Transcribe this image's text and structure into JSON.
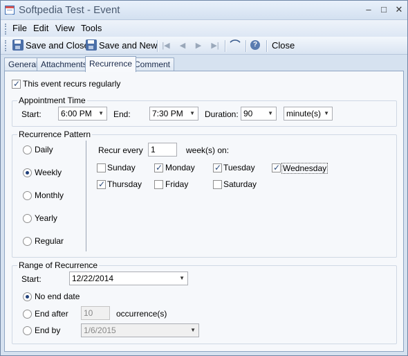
{
  "window": {
    "title": "Softpedia Test - Event",
    "minimize": "–",
    "maximize": "□",
    "close": "✕"
  },
  "menu": [
    "File",
    "Edit",
    "View",
    "Tools"
  ],
  "toolbar": {
    "save_close": "Save and Close",
    "save_new": "Save and New",
    "close": "Close"
  },
  "tabs": [
    "General",
    "Attachments",
    "Recurrence",
    "Comment"
  ],
  "recurrence": {
    "recurs_label": "This event recurs regularly",
    "recurs_checked": true,
    "appointment": {
      "title": "Appointment Time",
      "start_label": "Start:",
      "start_value": "6:00 PM",
      "end_label": "End:",
      "end_value": "7:30 PM",
      "duration_label": "Duration:",
      "duration_value": "90",
      "unit_value": "minute(s)"
    },
    "pattern": {
      "title": "Recurrence Pattern",
      "options": [
        "Daily",
        "Weekly",
        "Monthly",
        "Yearly",
        "Regular"
      ],
      "selected": "Weekly",
      "recur_every_label": "Recur every",
      "recur_every_value": "1",
      "weeks_on_label": "week(s) on:",
      "days": [
        {
          "name": "Sunday",
          "checked": false
        },
        {
          "name": "Monday",
          "checked": true
        },
        {
          "name": "Tuesday",
          "checked": true
        },
        {
          "name": "Wednesday",
          "checked": true
        },
        {
          "name": "Thursday",
          "checked": true
        },
        {
          "name": "Friday",
          "checked": false
        },
        {
          "name": "Saturday",
          "checked": false
        }
      ]
    },
    "range": {
      "title": "Range of Recurrence",
      "start_label": "Start:",
      "start_value": "12/22/2014",
      "no_end_label": "No end date",
      "end_after_label": "End after",
      "end_after_value": "10",
      "occurrences_label": "occurrence(s)",
      "end_by_label": "End by",
      "end_by_value": "1/6/2015",
      "selected": "No end date"
    }
  }
}
